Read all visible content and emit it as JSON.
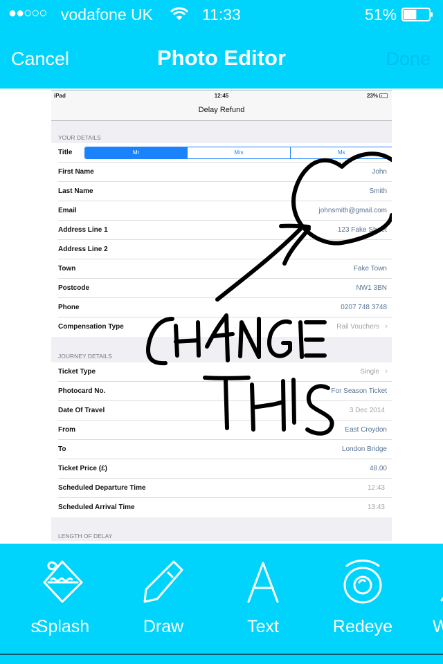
{
  "status_bar": {
    "signal": "●●○○○",
    "carrier": "vodafone UK",
    "time": "11:33",
    "battery_percent": "51%",
    "battery_level": 0.51
  },
  "nav": {
    "cancel_label": "Cancel",
    "title": "Photo Editor",
    "done_label": "Done"
  },
  "photo": {
    "ipad_status": {
      "device": "iPad",
      "time": "12:45",
      "battery": "23%"
    },
    "screen_title": "Delay Refund",
    "sections": [
      {
        "header": "YOUR DETAILS",
        "title_segments": [
          "Mr",
          "Mrs",
          "Ms"
        ],
        "title_selected": "Mr",
        "title_label": "Title",
        "rows": [
          {
            "label": "First Name",
            "value": "John"
          },
          {
            "label": "Last Name",
            "value": "Smith"
          },
          {
            "label": "Email",
            "value": "johnsmith@gmail.com"
          },
          {
            "label": "Address Line 1",
            "value": "123 Fake Street"
          },
          {
            "label": "Address Line 2",
            "value": ""
          },
          {
            "label": "Town",
            "value": "Fake Town"
          },
          {
            "label": "Postcode",
            "value": "NW1 3BN"
          },
          {
            "label": "Phone",
            "value": "0207 748 3748"
          },
          {
            "label": "Compensation Type",
            "value": "Rail Vouchers",
            "chevron": "›"
          }
        ]
      },
      {
        "header": "JOURNEY DETAILS",
        "rows": [
          {
            "label": "Ticket Type",
            "value": "Single",
            "chevron": "›"
          },
          {
            "label": "Photocard No.",
            "value": "For Season Ticket"
          },
          {
            "label": "Date Of Travel",
            "value": "3 Dec 2014"
          },
          {
            "label": "From",
            "value": "East Croydon"
          },
          {
            "label": "To",
            "value": "London Bridge"
          },
          {
            "label": "Ticket Price (£)",
            "value": "48.00"
          },
          {
            "label": "Scheduled Departure Time",
            "value": "12:43"
          },
          {
            "label": "Scheduled Arrival Time",
            "value": "13:43"
          }
        ]
      },
      {
        "header": "LENGTH OF DELAY"
      }
    ],
    "annotation_text": "CHANGE THIS"
  },
  "toolbar": {
    "tools": [
      {
        "label": "s",
        "icon": "partial-tool-icon"
      },
      {
        "label": "Splash",
        "icon": "paint-bucket-icon"
      },
      {
        "label": "Draw",
        "icon": "pencil-icon"
      },
      {
        "label": "Text",
        "icon": "letter-a-icon"
      },
      {
        "label": "Redeye",
        "icon": "eye-icon"
      },
      {
        "label": "W",
        "icon": "partial-tool-icon"
      }
    ]
  },
  "colors": {
    "brand": "#00d4fc",
    "done_disabled": "#00bff4",
    "segment_blue": "#1a82fb",
    "value_text": "#587392"
  }
}
